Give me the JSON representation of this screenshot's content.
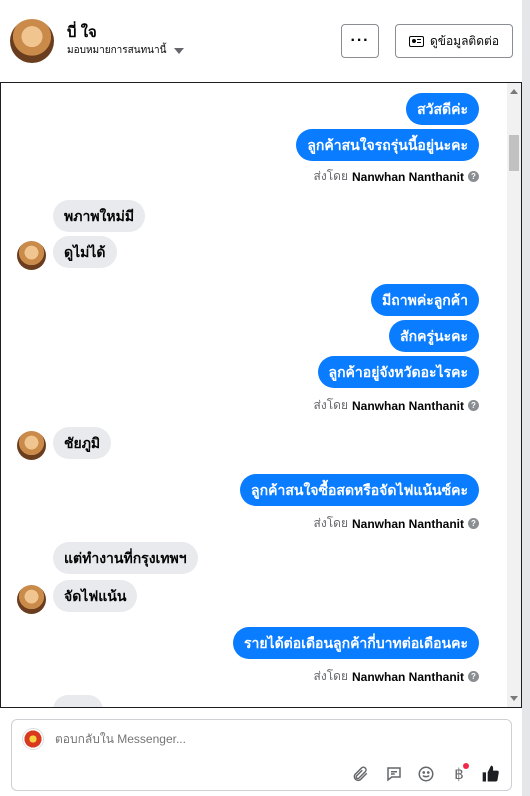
{
  "header": {
    "name": "บี่ ใจ",
    "assign_label": "มอบหมายการสนทนานี้",
    "contact_label": "ดูข้อมูลติดต่อ",
    "more_label": "···"
  },
  "messages": {
    "out1": "สวัสดีค่ะ",
    "out2": "ลูกค้าสนใจรถรุ่นนี้อยู่นะคะ",
    "in1": "พภาพใหม่มี",
    "in2": "ดูไม่ได้",
    "out3": "มีถาพค่ะลูกค้า",
    "out4": "สักครู่นะคะ",
    "out5": "ลูกค้าอยู่จังหวัดอะไรคะ",
    "in3": "ชัยภูมิ",
    "out6": "ลูกค้าสนใจซื้อสดหรือจัดไฟแน้นซ์คะ",
    "in4": "แต่ทำงานที่กรุงเทพฯ",
    "in5": "จัดไฟแน้น",
    "out7": "รายได้ต่อเดือนลูกค้ากี่บาทต่อเดือนคะ"
  },
  "sent_by": {
    "prefix": "ส่งโดย",
    "agent": "Nanwhan Nanthanit"
  },
  "reply": {
    "placeholder": "ตอบกลับใน Messenger..."
  },
  "icons": [
    "card-icon",
    "caret-down-icon",
    "help-icon",
    "attachment-icon",
    "chat-icon",
    "emoji-icon",
    "baht-icon",
    "thumbs-up-icon"
  ],
  "colors": {
    "outgoing": "#0a7cff",
    "incoming": "#e9eaee",
    "accent": "#0a7cff"
  }
}
